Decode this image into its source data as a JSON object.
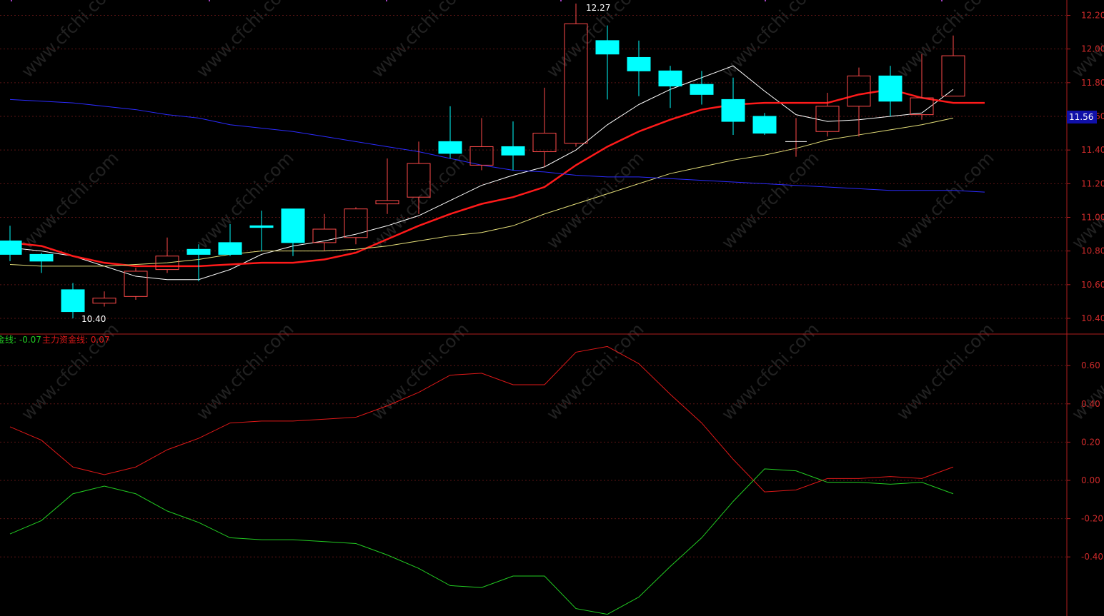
{
  "colors": {
    "background": "#000000",
    "axis": "#b01e1e",
    "grid": "#5a1414",
    "up": "#ff4a4a",
    "down": "#00ffff",
    "ma_fast": "#ffffff",
    "ma_mid": "#ff1a1a",
    "ma_slow": "#e6e07a",
    "ma_long": "#2b2bff",
    "indicator_red": "#e01818",
    "indicator_green": "#22cc22",
    "current_price_box": "#1010a8"
  },
  "watermark": "www.cfchi.com",
  "chart_data": [
    {
      "type": "candlestick",
      "ylim": [
        10.34,
        12.28
      ],
      "yticks": [
        10.4,
        10.6,
        10.8,
        11.0,
        11.2,
        11.4,
        11.6,
        11.8,
        12.0,
        12.2
      ],
      "ytick_labels": [
        "10.40",
        "10.60",
        "10.80",
        "11.00",
        "11.20",
        "11.40",
        "11.60",
        "11.80",
        "12.00",
        "12.20"
      ],
      "current_price": "11.56",
      "high_annotation": "12.27",
      "low_annotation": "10.40",
      "candles": [
        {
          "o": 10.86,
          "c": 10.78,
          "h": 10.95,
          "l": 10.74
        },
        {
          "o": 10.78,
          "c": 10.74,
          "h": 10.79,
          "l": 10.67
        },
        {
          "o": 10.57,
          "c": 10.44,
          "h": 10.61,
          "l": 10.4
        },
        {
          "o": 10.49,
          "c": 10.52,
          "h": 10.56,
          "l": 10.47
        },
        {
          "o": 10.53,
          "c": 10.68,
          "h": 10.7,
          "l": 10.51
        },
        {
          "o": 10.69,
          "c": 10.77,
          "h": 10.88,
          "l": 10.67
        },
        {
          "o": 10.81,
          "c": 10.78,
          "h": 10.84,
          "l": 10.62
        },
        {
          "o": 10.85,
          "c": 10.78,
          "h": 10.96,
          "l": 10.77
        },
        {
          "o": 10.95,
          "c": 10.94,
          "h": 11.04,
          "l": 10.8
        },
        {
          "o": 11.05,
          "c": 10.85,
          "h": 11.05,
          "l": 10.77
        },
        {
          "o": 10.85,
          "c": 10.93,
          "h": 11.02,
          "l": 10.8
        },
        {
          "o": 10.88,
          "c": 11.05,
          "h": 11.06,
          "l": 10.84
        },
        {
          "o": 11.08,
          "c": 11.1,
          "h": 11.35,
          "l": 11.02
        },
        {
          "o": 11.12,
          "c": 11.32,
          "h": 11.45,
          "l": 11.02
        },
        {
          "o": 11.45,
          "c": 11.38,
          "h": 11.66,
          "l": 11.35
        },
        {
          "o": 11.31,
          "c": 11.42,
          "h": 11.59,
          "l": 11.28
        },
        {
          "o": 11.42,
          "c": 11.37,
          "h": 11.57,
          "l": 11.28
        },
        {
          "o": 11.39,
          "c": 11.5,
          "h": 11.77,
          "l": 11.3
        },
        {
          "o": 11.44,
          "c": 12.15,
          "h": 12.27,
          "l": 11.42
        },
        {
          "o": 12.05,
          "c": 11.97,
          "h": 12.14,
          "l": 11.7
        },
        {
          "o": 11.95,
          "c": 11.87,
          "h": 12.05,
          "l": 11.72
        },
        {
          "o": 11.87,
          "c": 11.78,
          "h": 11.9,
          "l": 11.65
        },
        {
          "o": 11.79,
          "c": 11.73,
          "h": 11.87,
          "l": 11.67
        },
        {
          "o": 11.7,
          "c": 11.57,
          "h": 11.83,
          "l": 11.49
        },
        {
          "o": 11.6,
          "c": 11.5,
          "h": 11.62,
          "l": 11.49
        },
        {
          "o": 11.45,
          "c": 11.45,
          "h": 11.59,
          "l": 11.36
        },
        {
          "o": 11.51,
          "c": 11.66,
          "h": 11.74,
          "l": 11.48
        },
        {
          "o": 11.66,
          "c": 11.84,
          "h": 11.89,
          "l": 11.48
        },
        {
          "o": 11.84,
          "c": 11.69,
          "h": 11.9,
          "l": 11.6
        },
        {
          "o": 11.61,
          "c": 11.71,
          "h": 11.97,
          "l": 11.58
        },
        {
          "o": 11.72,
          "c": 11.96,
          "h": 12.08,
          "l": 11.72
        }
      ],
      "series": [
        {
          "name": "",
          "color": "ma_fast",
          "width": 1,
          "values": [
            10.82,
            10.8,
            10.77,
            10.71,
            10.65,
            10.63,
            10.63,
            10.69,
            10.78,
            10.83,
            10.86,
            10.9,
            10.95,
            11.01,
            11.1,
            11.19,
            11.25,
            11.3,
            11.4,
            11.55,
            11.67,
            11.76,
            11.83,
            11.9,
            11.75,
            11.61,
            11.57,
            11.58,
            11.6,
            11.62,
            11.76
          ]
        },
        {
          "name": "",
          "color": "ma_mid",
          "width": 2.5,
          "values": [
            10.85,
            10.83,
            10.77,
            10.73,
            10.71,
            10.71,
            10.71,
            10.72,
            10.73,
            10.73,
            10.75,
            10.79,
            10.87,
            10.95,
            11.02,
            11.08,
            11.12,
            11.18,
            11.31,
            11.42,
            11.51,
            11.58,
            11.64,
            11.67,
            11.68,
            11.68,
            11.68,
            11.73,
            11.76,
            11.71,
            11.68,
            11.68
          ]
        },
        {
          "name": "",
          "color": "ma_slow",
          "width": 1,
          "values": [
            10.72,
            10.71,
            10.71,
            10.71,
            10.72,
            10.73,
            10.75,
            10.78,
            10.8,
            10.8,
            10.8,
            10.81,
            10.83,
            10.86,
            10.89,
            10.91,
            10.95,
            11.02,
            11.08,
            11.14,
            11.2,
            11.26,
            11.3,
            11.34,
            11.37,
            11.41,
            11.46,
            11.49,
            11.52,
            11.55,
            11.59
          ]
        },
        {
          "name": "",
          "color": "ma_long",
          "width": 1,
          "values": [
            11.7,
            11.69,
            11.68,
            11.66,
            11.64,
            11.61,
            11.59,
            11.55,
            11.53,
            11.51,
            11.48,
            11.45,
            11.42,
            11.39,
            11.35,
            11.31,
            11.28,
            11.27,
            11.25,
            11.24,
            11.24,
            11.23,
            11.22,
            11.21,
            11.2,
            11.19,
            11.18,
            11.17,
            11.16,
            11.16,
            11.16,
            11.15
          ]
        }
      ]
    },
    {
      "type": "line",
      "ylim": [
        -0.73,
        0.72
      ],
      "yticks": [
        0.6,
        0.4,
        0.2,
        0.0,
        -0.2,
        -0.4
      ],
      "ytick_labels": [
        "0.60",
        "0.40",
        "0.20",
        "0.00",
        "-0.20",
        "-0.40"
      ],
      "legend": [
        {
          "text": "金线: -0.07",
          "color": "indicator_green"
        },
        {
          "text": "主力资金线: 0.07",
          "color": "indicator_red"
        }
      ],
      "series": [
        {
          "name": "主力资金线",
          "color": "indicator_red",
          "values": [
            0.28,
            0.21,
            0.07,
            0.03,
            0.07,
            0.16,
            0.22,
            0.3,
            0.31,
            0.31,
            0.32,
            0.33,
            0.39,
            0.46,
            0.55,
            0.56,
            0.5,
            0.5,
            0.67,
            0.7,
            0.61,
            0.45,
            0.3,
            0.11,
            -0.06,
            -0.05,
            0.01,
            0.01,
            0.02,
            0.01,
            0.07
          ]
        },
        {
          "name": "金线",
          "color": "indicator_green",
          "values": [
            -0.28,
            -0.21,
            -0.07,
            -0.03,
            -0.07,
            -0.16,
            -0.22,
            -0.3,
            -0.31,
            -0.31,
            -0.32,
            -0.33,
            -0.39,
            -0.46,
            -0.55,
            -0.56,
            -0.5,
            -0.5,
            -0.67,
            -0.7,
            -0.61,
            -0.45,
            -0.3,
            -0.11,
            0.06,
            0.05,
            -0.01,
            -0.01,
            -0.02,
            -0.01,
            -0.07
          ]
        }
      ]
    }
  ]
}
